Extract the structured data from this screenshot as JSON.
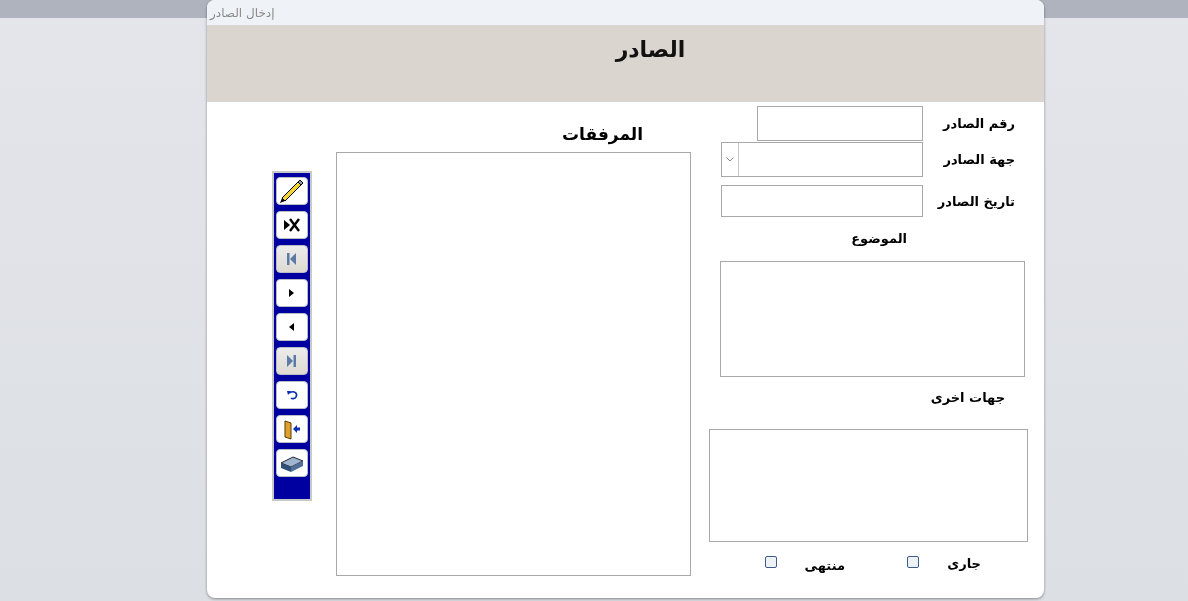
{
  "window": {
    "title": "إدخال الصادر"
  },
  "header": {
    "title": "الصادر"
  },
  "fields": [
    {
      "kind": "text",
      "label": "رقم الصادر"
    },
    {
      "kind": "select",
      "label": "جهة الصادر"
    },
    {
      "kind": "text",
      "label": "تاريخ الصادر"
    }
  ],
  "subject": {
    "label": "الموضوع"
  },
  "other_parties": {
    "label": "جهات اخرى"
  },
  "status_options": [
    {
      "label": "جارى",
      "checked": false
    },
    {
      "label": "منتهى",
      "checked": false
    }
  ],
  "attachments": {
    "title": "المرفقات"
  },
  "toolbar": [
    {
      "kind": "edit",
      "disabled": false
    },
    {
      "kind": "delete",
      "disabled": false
    },
    {
      "kind": "first",
      "disabled": true
    },
    {
      "kind": "next",
      "disabled": false
    },
    {
      "kind": "previous",
      "disabled": false
    },
    {
      "kind": "last",
      "disabled": true
    },
    {
      "kind": "undo",
      "disabled": false
    },
    {
      "kind": "exit",
      "disabled": false
    },
    {
      "kind": "scan",
      "disabled": false
    }
  ]
}
